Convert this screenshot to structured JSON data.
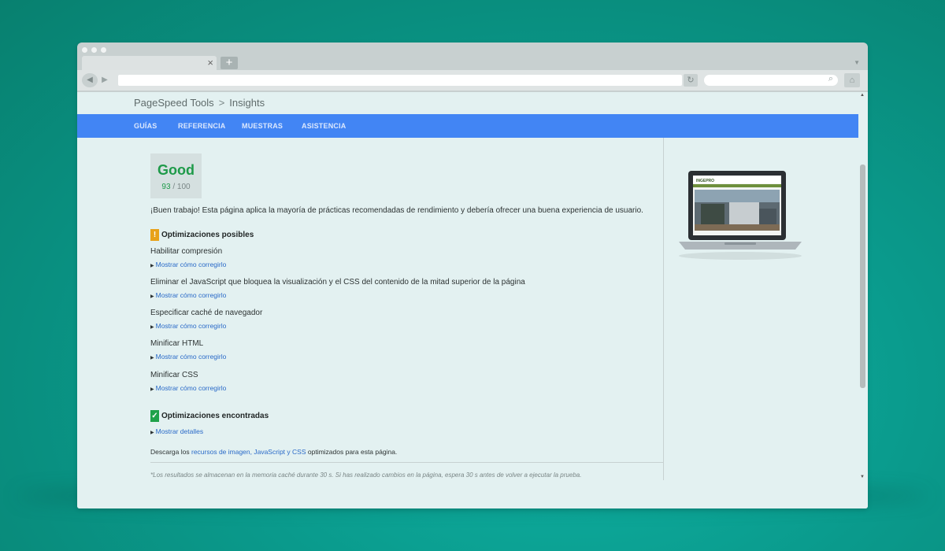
{
  "browser": {
    "tab_close_icon": "×",
    "new_tab_icon": "+",
    "back_icon": "◀",
    "forward_icon": "▶",
    "reload_icon": "↻",
    "search_icon": "⌕",
    "home_icon": "⌂",
    "url": "",
    "search_placeholder": ""
  },
  "breadcrumb": {
    "root": "PageSpeed Tools",
    "separator": ">",
    "current": "Insights"
  },
  "navbar": {
    "items": [
      "GUÍAS",
      "REFERENCIA",
      "MUESTRAS",
      "ASISTENCIA"
    ]
  },
  "score": {
    "label": "Good",
    "value": "93",
    "max": "/ 100",
    "color": "#1e9a49"
  },
  "summary": "¡Buen trabajo! Esta página aplica la mayoría de prácticas recomendadas de rendimiento y debería ofrecer una buena experiencia de usuario.",
  "possible": {
    "heading": "Optimizaciones posibles",
    "badge": "!",
    "badge_color": "#e8a21a",
    "items": [
      {
        "title": "Habilitar compresión",
        "link": "Mostrar cómo corregirlo"
      },
      {
        "title": "Eliminar el JavaScript que bloquea la visualización y el CSS del contenido de la mitad superior de la página",
        "link": "Mostrar cómo corregirlo"
      },
      {
        "title": "Especificar caché de navegador",
        "link": "Mostrar cómo corregirlo"
      },
      {
        "title": "Minificar HTML",
        "link": "Mostrar cómo corregirlo"
      },
      {
        "title": "Minificar CSS",
        "link": "Mostrar cómo corregirlo"
      }
    ]
  },
  "found": {
    "heading": "Optimizaciones encontradas",
    "badge": "✓",
    "badge_color": "#1fa24a",
    "link": "Mostrar detalles"
  },
  "download": {
    "prefix": "Descarga los",
    "link": "recursos de imagen, JavaScript y CSS",
    "suffix": "optimizados para esta página."
  },
  "footnote": "*Los resultados se almacenan en la memoria caché durante 30 s. Si has realizado cambios en la página, espera 30 s antes de volver a ejecutar la prueba.",
  "preview": {
    "screen_logo": "INGEPRO"
  },
  "colors": {
    "background": "#0a9a8c",
    "navbar": "#4285f4",
    "link": "#2a6ac8"
  }
}
